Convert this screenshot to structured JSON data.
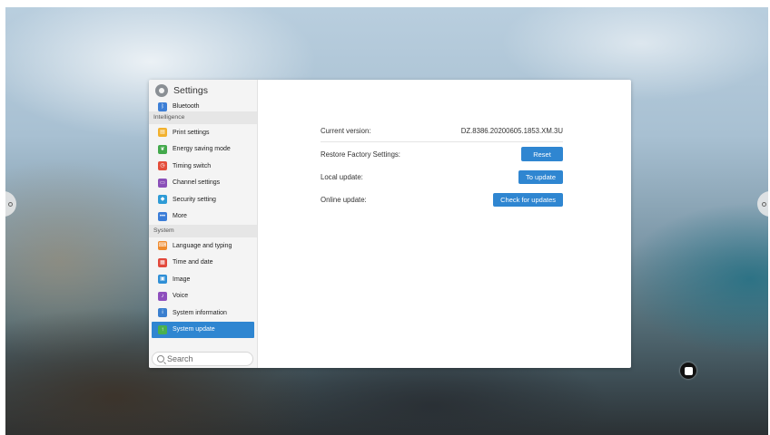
{
  "sidebar": {
    "title": "Settings",
    "partial_item": {
      "label": "Bluetooth",
      "icon": "bluetooth-icon",
      "color": "#3d7fd6"
    },
    "sections": [
      {
        "label": "Intelligence",
        "items": [
          {
            "label": "Print settings",
            "icon": "print-icon",
            "color": "#f2b12e"
          },
          {
            "label": "Energy saving mode",
            "icon": "leaf-icon",
            "color": "#43a94b"
          },
          {
            "label": "Timing switch",
            "icon": "clock-icon",
            "color": "#e44d3a"
          },
          {
            "label": "Channel settings",
            "icon": "channel-icon",
            "color": "#8a4fb8"
          },
          {
            "label": "Security setting",
            "icon": "shield-icon",
            "color": "#2e9bd6"
          },
          {
            "label": "More",
            "icon": "more-icon",
            "color": "#3b7dd8"
          }
        ]
      },
      {
        "label": "System",
        "items": [
          {
            "label": "Language and typing",
            "icon": "keyboard-icon",
            "color": "#ef8a2c"
          },
          {
            "label": "Time and date",
            "icon": "calendar-icon",
            "color": "#e2483b"
          },
          {
            "label": "Image",
            "icon": "image-icon",
            "color": "#2f8fd6"
          },
          {
            "label": "Voice",
            "icon": "speaker-icon",
            "color": "#8e4fbd"
          },
          {
            "label": "System information",
            "icon": "info-icon",
            "color": "#3a7fcf"
          },
          {
            "label": "System update",
            "icon": "update-icon",
            "color": "#49b04e",
            "active": true
          }
        ]
      }
    ],
    "search_placeholder": "Search"
  },
  "main": {
    "current_version": {
      "label": "Current version:",
      "value": "DZ.8386.20200605.1853.XM.3U"
    },
    "restore": {
      "label": "Restore Factory Settings:",
      "button": "Reset"
    },
    "local_update": {
      "label": "Local update:",
      "button": "To update"
    },
    "online_update": {
      "label": "Online update:",
      "button": "Check for updates"
    }
  },
  "colors": {
    "accent": "#2f86d1",
    "active_item_bg": "#2f86d1",
    "section_bg": "#e6e6e6"
  }
}
